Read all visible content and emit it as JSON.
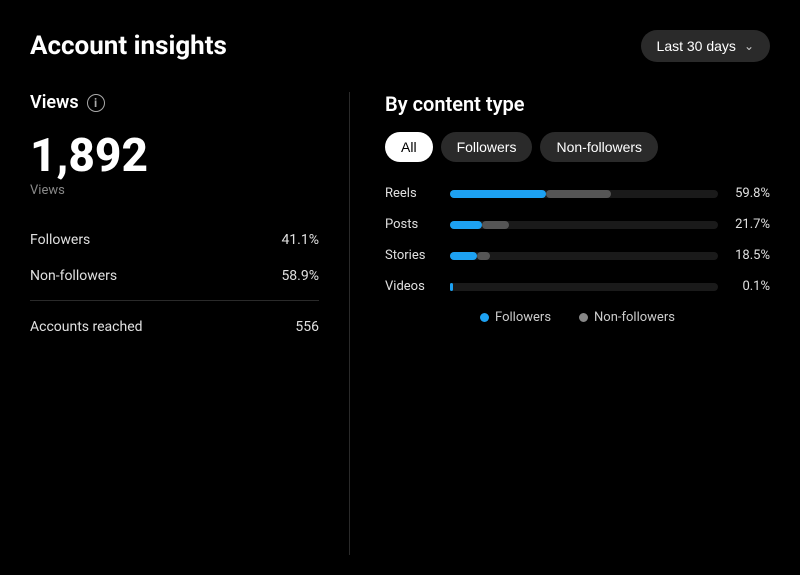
{
  "header": {
    "title": "Account insights",
    "date_filter_label": "Last 30 days"
  },
  "left": {
    "section_label": "Views",
    "info_icon_label": "i",
    "views_count": "1,892",
    "views_sublabel": "Views",
    "stats": [
      {
        "label": "Followers",
        "value": "41.1%"
      },
      {
        "label": "Non-followers",
        "value": "58.9%"
      }
    ],
    "accounts_reached_label": "Accounts reached",
    "accounts_reached_value": "556"
  },
  "right": {
    "section_label": "By content type",
    "tabs": [
      {
        "label": "All",
        "active": true
      },
      {
        "label": "Followers",
        "active": false
      },
      {
        "label": "Non-followers",
        "active": false
      }
    ],
    "bars": [
      {
        "label": "Reels",
        "followers_pct": 36,
        "nonfollowers_pct": 24,
        "display_value": "59.8%"
      },
      {
        "label": "Posts",
        "followers_pct": 12,
        "nonfollowers_pct": 10,
        "display_value": "21.7%"
      },
      {
        "label": "Stories",
        "followers_pct": 10,
        "nonfollowers_pct": 5,
        "display_value": "18.5%"
      },
      {
        "label": "Videos",
        "followers_pct": 1,
        "nonfollowers_pct": 0,
        "display_value": "0.1%"
      }
    ],
    "legend": [
      {
        "key": "followers",
        "label": "Followers",
        "color_class": "followers"
      },
      {
        "key": "nonfollowers",
        "label": "Non-followers",
        "color_class": "nonfollowers"
      }
    ]
  }
}
